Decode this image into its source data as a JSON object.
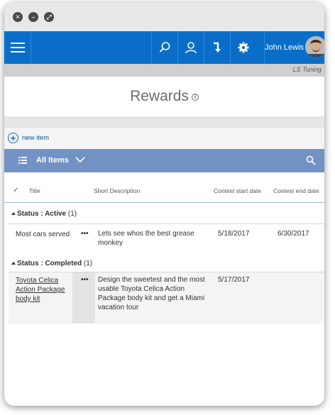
{
  "window": {
    "controls": [
      "close",
      "minimize",
      "expand"
    ]
  },
  "appbar": {
    "user_name": "John Lewis",
    "icons": [
      "menu-icon",
      "search-icon",
      "person-icon",
      "arrow-down-icon",
      "gear-icon"
    ],
    "accent": "#0a6ec9"
  },
  "site": {
    "name": "LS Tuning"
  },
  "page": {
    "title": "Rewards"
  },
  "toolbar": {
    "new_item": "new item"
  },
  "view": {
    "label": "All Items",
    "bar_color": "#7292c4"
  },
  "columns": [
    "Title",
    "Short Description",
    "Contest start date",
    "Contest end date"
  ],
  "groups": [
    {
      "label": "Status : Active",
      "count": "(1)",
      "rows": [
        {
          "title": "Most cars served",
          "menu": "•••",
          "description": "Lets see whos the best grease monkey",
          "start": "5/18/2017",
          "end": "6/30/2017"
        }
      ]
    },
    {
      "label": "Status : Completed",
      "count": "(1)",
      "rows": [
        {
          "title": "Toyota Celica Action Package body kit",
          "menu": "•••",
          "description": "Design the sweetest and the most usable Toyota Celica Action Package body kit and get a Miami vacation tour",
          "start": "5/17/2017",
          "end": ""
        }
      ]
    }
  ]
}
